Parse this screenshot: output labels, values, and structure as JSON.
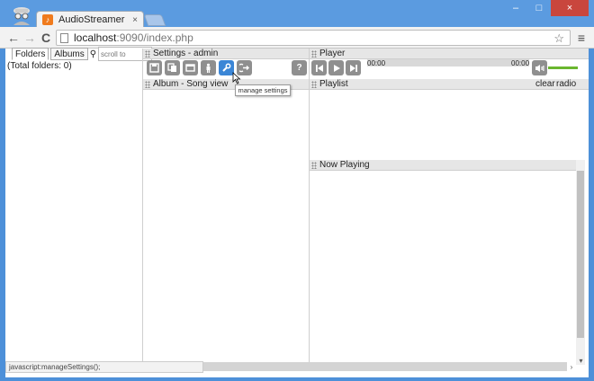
{
  "browser": {
    "tab_title": "AudioStreamer",
    "tab_close": "×",
    "url_host": "localhost",
    "url_rest": ":9090/index.php",
    "back": "←",
    "forward": "→",
    "reload": "C",
    "star": "☆",
    "menu": "≡",
    "win_min": "–",
    "win_max": "□",
    "win_close": "×"
  },
  "library": {
    "tab_folders": "Folders",
    "tab_albums": "Albums",
    "scroll_placeholder": "scroll to",
    "total_folders": "(Total folders: 0)"
  },
  "settings": {
    "header": "Settings - admin",
    "tooltip": "manage settings",
    "help": "?"
  },
  "album_view": {
    "header": "Album - Song view"
  },
  "player": {
    "header": "Player",
    "time_elapsed": "00:00",
    "time_total": "00:00",
    "progress": 0.0,
    "volume": 1.0
  },
  "playlist": {
    "header": "Playlist",
    "clear": "clear",
    "radio": "radio"
  },
  "now_playing": {
    "header": "Now Playing"
  },
  "statusbar": {
    "text": "javascript:manageSettings();"
  },
  "colors": {
    "accent": "#3b86d6",
    "volume": "#6ab62f",
    "titlebar": "#5b9be0"
  }
}
